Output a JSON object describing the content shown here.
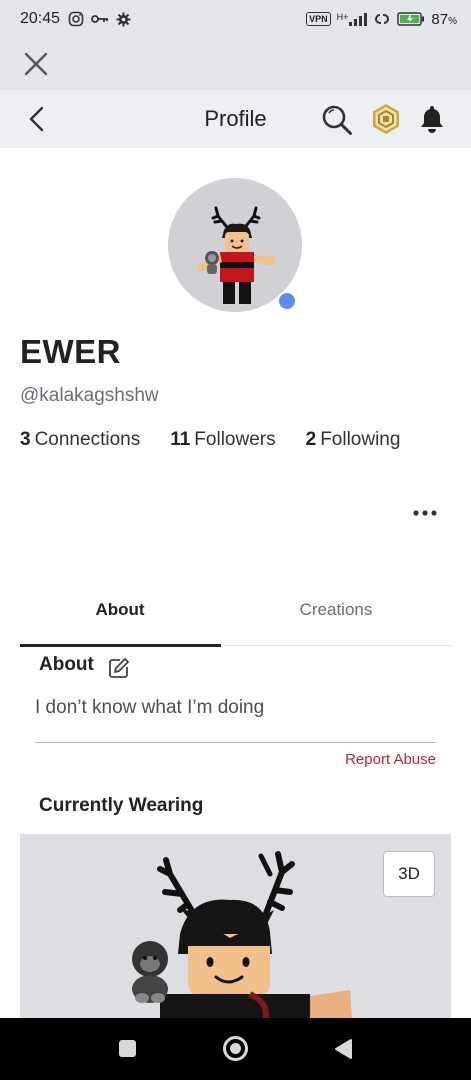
{
  "status_bar": {
    "time": "20:45",
    "vpn": "VPN",
    "network": "H+",
    "battery_percent": "87",
    "battery_suffix": "%"
  },
  "nav": {
    "title": "Profile"
  },
  "profile": {
    "display_name": "EWER",
    "username": "@kalakagshshw",
    "online": true,
    "online_color": "#5b8df5",
    "stats": [
      {
        "count": "3",
        "label": "Connections"
      },
      {
        "count": "11",
        "label": "Followers"
      },
      {
        "count": "2",
        "label": "Following"
      }
    ]
  },
  "tabs": [
    {
      "label": "About",
      "active": true
    },
    {
      "label": "Creations",
      "active": false
    }
  ],
  "about": {
    "title": "About",
    "description": "I don’t know what I’m doing",
    "report_label": "Report Abuse",
    "report_color": "#c1272d"
  },
  "currently_wearing": {
    "title": "Currently Wearing",
    "view_3d_label": "3D"
  }
}
